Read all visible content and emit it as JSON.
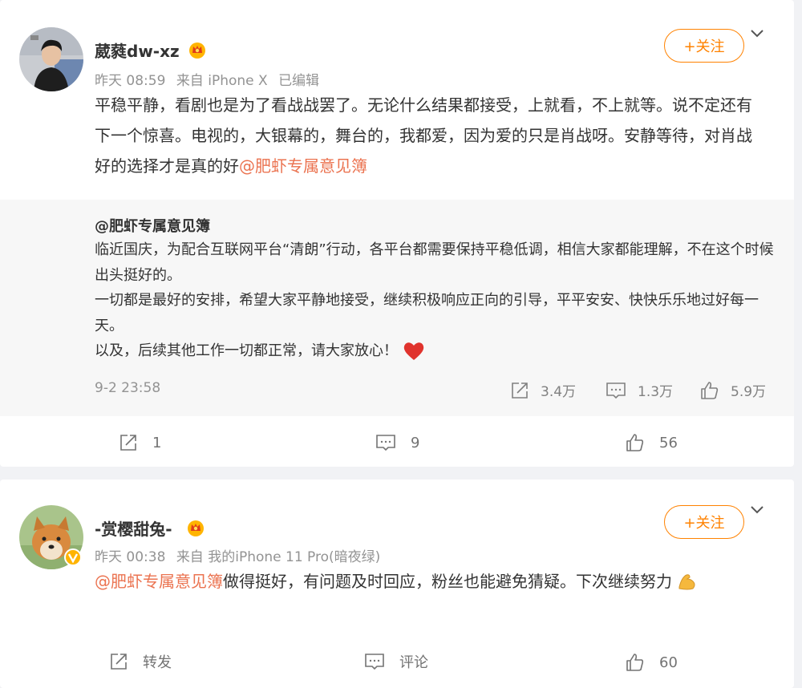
{
  "posts": [
    {
      "author": "葳蕤dw-xz",
      "meta": {
        "time": "昨天 08:59",
        "source": "来自 iPhone X",
        "edited": "已编辑"
      },
      "follow_label": "+关注",
      "text": "平稳平静，看剧也是为了看战战罢了。无论什么结果都接受，上就看，不上就等。说不定还有下一个惊喜。电视的，大银幕的，舞台的，我都爱，因为爱的只是肖战呀。安静等待，对肖战好的选择才是真的好",
      "mention": "@肥虾专属意见簿",
      "retweet": {
        "author": "@肥虾专属意见簿",
        "line1": "临近国庆，为配合互联网平台“清朗”行动，各平台都需要保持平稳低调，相信大家都能理解，不在这个时候出头挺好的。",
        "line2": "一切都是最好的安排，希望大家平静地接受，继续积极响应正向的引导，平平安安、快快乐乐地过好每一天。",
        "line3": "以及，后续其他工作一切都正常，请大家放心！",
        "time": "9-2 23:58",
        "reposts": "3.4万",
        "comments": "1.3万",
        "likes": "5.9万"
      },
      "actions": {
        "repost": "1",
        "comment": "9",
        "like": "56"
      }
    },
    {
      "author": "-赏樱甜兔-",
      "meta": {
        "time": "昨天 00:38",
        "source": "来自 我的iPhone 11 Pro(暗夜绿)"
      },
      "follow_label": "+关注",
      "mention": "@肥虾专属意见簿",
      "text": " 做得挺好，有问题及时回应，粉丝也能避免猜疑。下次继续努力",
      "actions": {
        "repost": "转发",
        "comment": "评论",
        "like": "60"
      }
    }
  ],
  "icons": {
    "crown": "vip-crown-icon",
    "chevron": "chevron-down-icon",
    "repost": "repost-icon",
    "comment": "comment-icon",
    "like": "thumbs-up-icon",
    "heart": "red-heart-emoji",
    "muscle": "flexed-biceps-emoji"
  },
  "colors": {
    "accent": "#ff8200",
    "mention": "#eb7350",
    "meta": "#939393",
    "retweet_bg": "#f7f7f7",
    "page_bg": "#f1f2f5"
  }
}
